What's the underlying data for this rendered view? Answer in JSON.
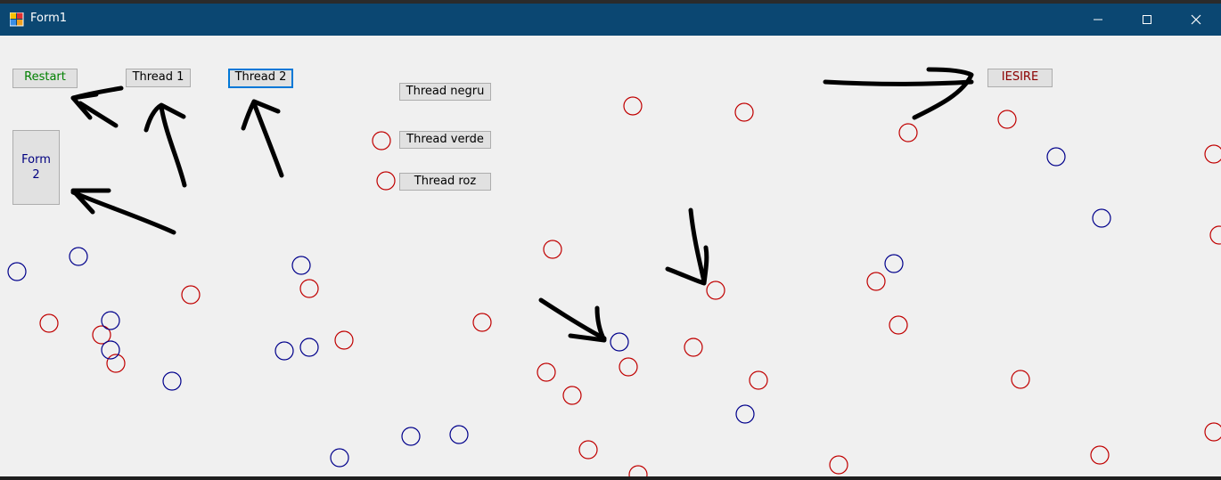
{
  "window": {
    "title": "Form1",
    "minimize_icon": "minimize-icon",
    "maximize_icon": "maximize-icon",
    "close_icon": "close-icon"
  },
  "buttons": {
    "restart": {
      "label": "Restart",
      "color": "#008000"
    },
    "thread1": {
      "label": "Thread 1"
    },
    "thread2": {
      "label": "Thread 2"
    },
    "thread_negru": {
      "label": "Thread negru"
    },
    "thread_verde": {
      "label": "Thread verde"
    },
    "thread_roz": {
      "label": "Thread roz"
    },
    "form2": {
      "label": "Form\n2",
      "color": "#000080"
    },
    "iesire": {
      "label": "IESIRE",
      "color": "#8b0000"
    }
  },
  "colors": {
    "red_circle": "#c00000",
    "blue_circle": "#00008b",
    "arrow": "#000000",
    "titlebar": "#0b4772"
  },
  "annotations": {
    "arrows": "black hand-drawn arrows pointing at controls and circles"
  }
}
